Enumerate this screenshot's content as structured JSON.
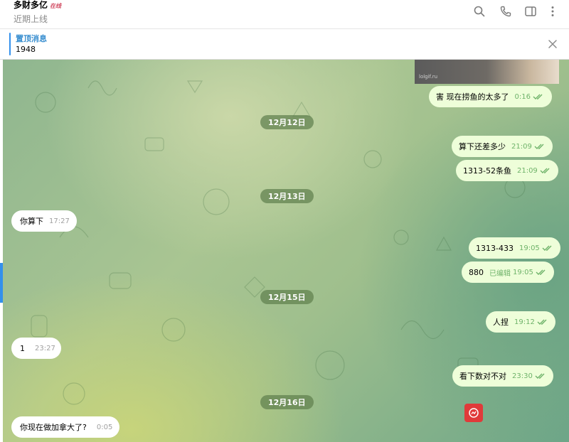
{
  "header": {
    "chat_name": "多财多亿",
    "name_tag": "在线",
    "status": "近期上线",
    "icons": [
      "search-icon",
      "phone-icon",
      "sidebar-icon",
      "more-icon"
    ]
  },
  "pinned": {
    "title": "置顶消息",
    "text": "1948"
  },
  "photo": {
    "watermark": "lolgif.ru"
  },
  "messages": [
    {
      "text": "害 现在捞鱼的太多了",
      "time": "0:16",
      "dir": "out"
    },
    {
      "text": "算下还差多少",
      "time": "21:09",
      "dir": "out"
    },
    {
      "text": "1313-52条鱼",
      "time": "21:09",
      "dir": "out"
    },
    {
      "text": "你算下",
      "time": "17:27",
      "dir": "in"
    },
    {
      "text": "1313-433",
      "time": "19:05",
      "dir": "out"
    },
    {
      "text": "880",
      "time": "19:05",
      "edited": "已编辑",
      "dir": "out"
    },
    {
      "text": "人捏",
      "time": "19:12",
      "dir": "out"
    },
    {
      "text": "1",
      "time": "23:27",
      "dir": "in"
    },
    {
      "text": "看下数对不对",
      "time": "23:30",
      "dir": "out"
    },
    {
      "text": "你现在做加拿大了?",
      "time": "0:05",
      "dir": "in"
    }
  ],
  "dates": [
    "12月12日",
    "12月13日",
    "12月15日",
    "12月16日"
  ],
  "colors": {
    "accent": "#3390ec",
    "outgoing_bubble": "#eefed9",
    "incoming_bubble": "#ffffff",
    "tick": "#6fb36a",
    "date_pill": "#60804e"
  }
}
